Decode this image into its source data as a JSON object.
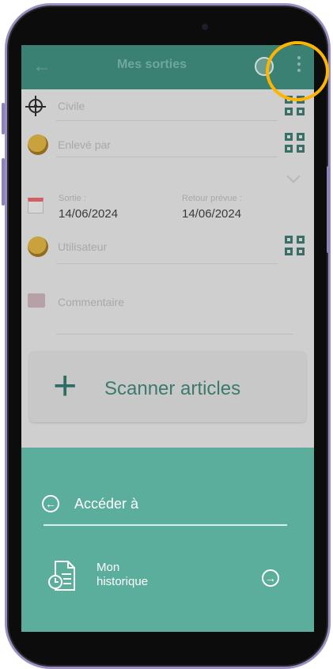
{
  "header": {
    "back_icon": "arrow-left-icon",
    "title": "Mes sorties",
    "more_icon": "vertical-dots-icon"
  },
  "form": {
    "civil_label": "Civile",
    "enleve_label": "Enlevé par",
    "sortie_label": "Sortie :",
    "sortie_value": "14/06/2024",
    "retour_label": "Retour prévue :",
    "retour_value": "14/06/2024",
    "utilisateur_label": "Utilisateur",
    "commentaire_label": "Commentaire"
  },
  "scan": {
    "label": "Scanner articles"
  },
  "sheet": {
    "acceder_label": "Accéder à",
    "historique_label_line1": "Mon",
    "historique_label_line2": "historique"
  },
  "colors": {
    "accent": "#3b8173",
    "sheet": "#5aae9b",
    "highlight": "#ffb400"
  }
}
